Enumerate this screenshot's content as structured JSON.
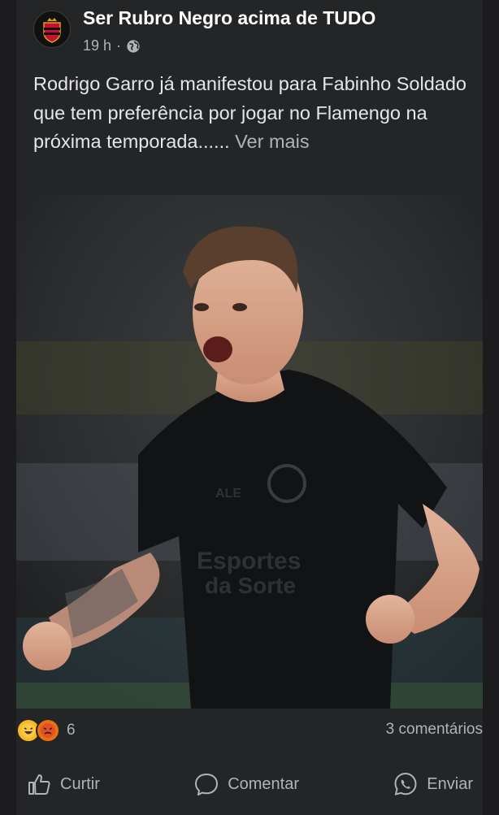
{
  "post": {
    "page_name": "Ser Rubro Negro acima de TUDO",
    "time": "19 h",
    "separator": "·",
    "visibility_icon": "globe-icon",
    "caption": "Rodrigo Garro já manifestou para Fabinho Soldado que tem preferência por jogar no Flamengo na próxima temporada......",
    "see_more": " Ver mais"
  },
  "photo": {
    "jersey_text_1": "Esportes",
    "jersey_text_2": "da Sorte",
    "sponsor": "ALE"
  },
  "stats": {
    "reaction_icons": [
      "haha-icon",
      "angry-icon"
    ],
    "reaction_count": "6",
    "comments": "3 comentários"
  },
  "actions": {
    "like": "Curtir",
    "comment": "Comentar",
    "share": "Enviar"
  },
  "colors": {
    "background": "#242526",
    "text": "#e4e6eb",
    "muted": "#b0b3b8"
  }
}
